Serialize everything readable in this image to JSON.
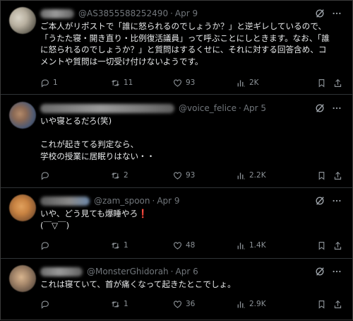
{
  "tweets": [
    {
      "handle": "@AS3855588252490",
      "date": "Apr 9",
      "lines": [
        "ご本人がリポストで「誰に怒られるのでしょうか？」と逆ギレしているので、",
        "「うたた寝・開き直り・比例復活議員」って呼ぶことにしときます。なお、「誰",
        "に怒られるのでしょうか？」と質問はするくせに、それに対する回答含め、コ",
        "メントや質問は一切受け付けないようです。"
      ],
      "replies": "1",
      "reposts": "11",
      "likes": "93",
      "views": "2K"
    },
    {
      "handle": "@voice_felice",
      "date": "Apr 5",
      "lines": [
        "いや寝とるだろ(笑)",
        "",
        "これが起きてる判定なら、",
        "学校の授業に居眠りはない・・"
      ],
      "replies": "",
      "reposts": "2",
      "likes": "93",
      "views": "2.2K"
    },
    {
      "handle": "@zam_spoon",
      "date": "Apr 9",
      "line1": "いや、どう見ても爆睡やろ",
      "line1_mark": "❗",
      "line2": "(￣▽￣)",
      "replies": "",
      "reposts": "1",
      "likes": "48",
      "views": "1.4K"
    },
    {
      "handle": "@MonsterGhidorah",
      "date": "Apr 6",
      "lines": [
        "これは寝ていて、首が痛くなって起きたとこでしょ。"
      ],
      "replies": "",
      "reposts": "1",
      "likes": "36",
      "views": "2.9K"
    }
  ],
  "dot": "·",
  "colors": {
    "background": "#000000",
    "text": "#e7e9ea",
    "muted": "#71767b",
    "divider": "#2f3336"
  },
  "icons": [
    "reply-icon",
    "repost-icon",
    "like-icon",
    "views-icon",
    "bookmark-icon",
    "share-icon",
    "grok-icon",
    "more-icon"
  ]
}
